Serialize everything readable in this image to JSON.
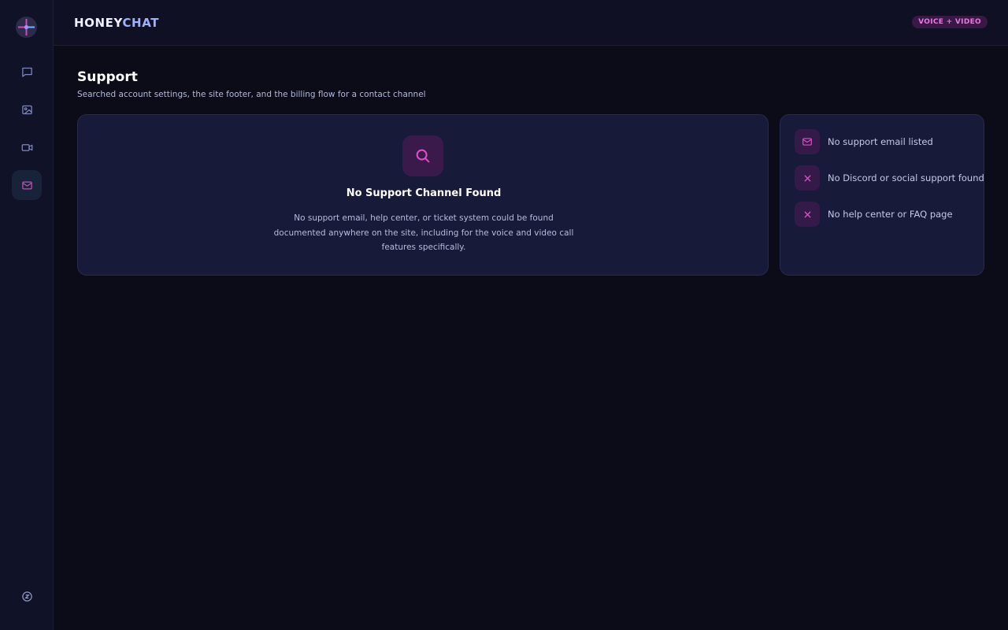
{
  "header": {
    "brand_part1": "HONEY",
    "brand_part2": "CHAT",
    "badge": "VOICE + VIDEO"
  },
  "sidebar": {
    "items": [
      {
        "icon": "chat-icon",
        "active": false
      },
      {
        "icon": "image-icon",
        "active": false
      },
      {
        "icon": "video-icon",
        "active": false
      },
      {
        "icon": "mail-icon",
        "active": true
      }
    ],
    "footer_icon": "coin-icon"
  },
  "page": {
    "title": "Support",
    "subtitle": "Searched account settings, the site footer, and the billing flow for a contact channel"
  },
  "main_card": {
    "icon": "search-icon",
    "title": "No Support Channel Found",
    "description": "No support email, help center, or ticket system could be found documented anywhere on the site, including for the voice and video call features specifically."
  },
  "side_card": {
    "items": [
      {
        "icon": "mail-icon",
        "label": "No support email listed"
      },
      {
        "icon": "close-icon",
        "label": "No Discord or social support found"
      },
      {
        "icon": "close-icon",
        "label": "No help center or FAQ page"
      }
    ]
  },
  "colors": {
    "background": "#0b0c18",
    "sidebar": "#101228",
    "card": "#171a38",
    "accent_pink": "#e04fc8",
    "accent_blue": "#9fb0ff",
    "badge_bg": "#3a1846"
  }
}
